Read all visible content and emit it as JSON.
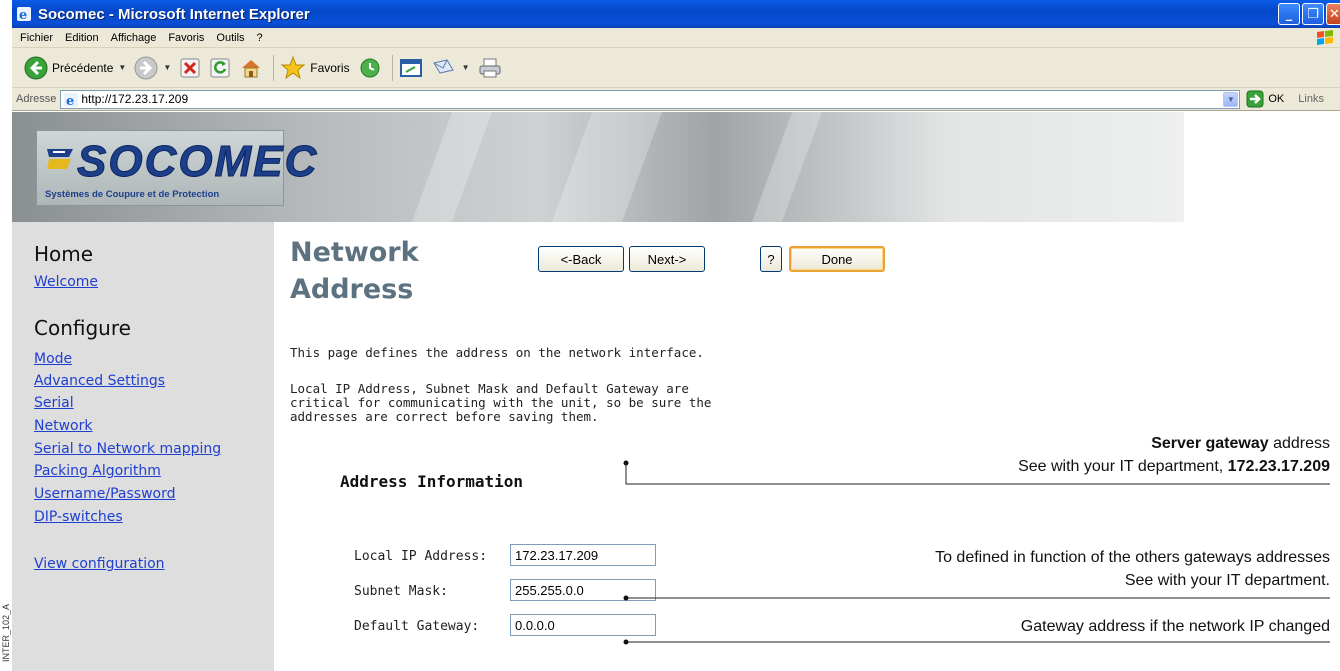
{
  "doc_code": "INTER_102_A",
  "window": {
    "title": "Socomec - Microsoft Internet Explorer",
    "buttons": [
      "minimize",
      "restore",
      "close"
    ]
  },
  "menubar": [
    "Fichier",
    "Edition",
    "Affichage",
    "Favoris",
    "Outils",
    "?"
  ],
  "toolbar": {
    "back_label": "Précédente",
    "favorites_label": "Favoris",
    "icons": [
      "back-arrow-icon",
      "forward-arrow-icon",
      "stop-icon",
      "refresh-icon",
      "home-icon",
      "favorites-star-icon",
      "history-icon",
      "media-icon",
      "mail-icon",
      "print-icon"
    ]
  },
  "addressbar": {
    "label": "Adresse",
    "url": "http://172.23.17.209",
    "go_label": "OK",
    "links_label": "Links"
  },
  "banner": {
    "logo_text": "SOCOMEC",
    "tagline": "Systèmes de Coupure et de Protection"
  },
  "sidebar": {
    "home_heading": "Home",
    "welcome": "Welcome",
    "configure_heading": "Configure",
    "items": [
      "Mode",
      "Advanced Settings",
      "Serial",
      "Network",
      "Serial to Network mapping",
      "Packing Algorithm",
      "Username/Password",
      "DIP-switches"
    ],
    "view_configuration": "View configuration"
  },
  "main": {
    "title": "Network Address",
    "back_button": "<-Back",
    "next_button": "Next->",
    "help_button": "?",
    "done_button": "Done",
    "intro": "This page defines the address on the network interface.",
    "note": "Local IP Address, Subnet Mask and Default Gateway are\ncritical for communicating with the unit, so be sure the\naddresses are correct before saving them.",
    "section_heading": "Address Information",
    "fields": [
      {
        "label": "Local IP Address:",
        "value": "172.23.17.209"
      },
      {
        "label": "Subnet Mask:",
        "value": "255.255.0.0"
      },
      {
        "label": "Default Gateway:",
        "value": "0.0.0.0"
      }
    ]
  },
  "annotations": {
    "gateway_bold": "Server gateway",
    "gateway_rest": " address",
    "gateway_line2_prefix": "See with your IT department, ",
    "gateway_line2_bold": "172.23.17.209",
    "mask_line1": "To defined in function of the others gateways addresses",
    "mask_line2": "See with your IT department.",
    "default_gw": "Gateway address if the network IP changed"
  }
}
